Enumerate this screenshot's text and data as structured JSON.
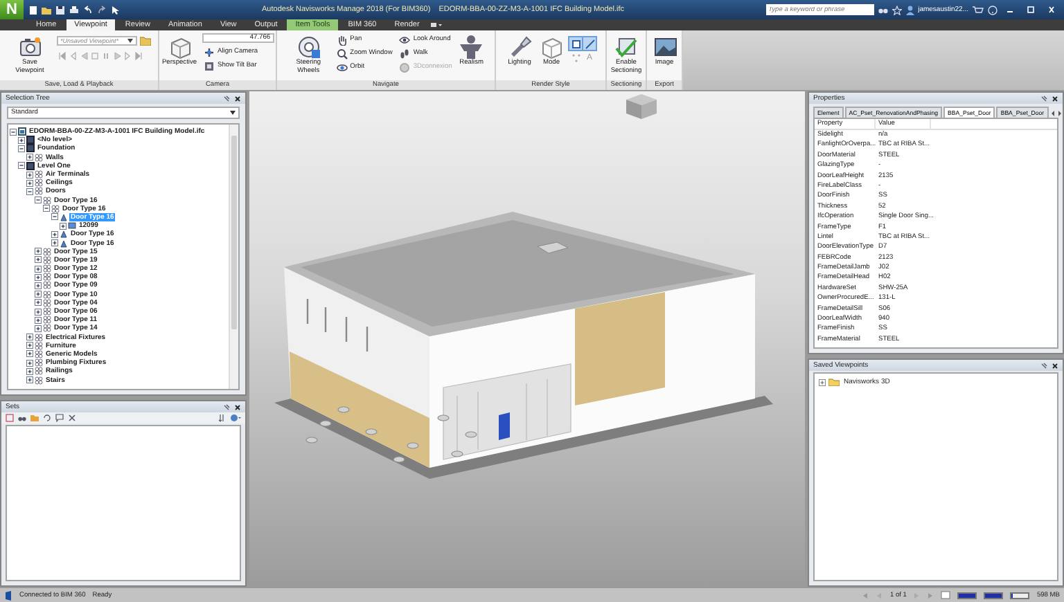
{
  "title_bar": {
    "logo": "N",
    "app_title": "Autodesk Navisworks Manage 2018 (For BIM360)",
    "document_title": "EDORM-BBA-00-ZZ-M3-A-1001 IFC Building Model.ifc",
    "search": {
      "placeholder": "Type a keyword or phrase"
    },
    "user": "jamesaustin22..."
  },
  "tabs": [
    {
      "label": "Home",
      "selected": false,
      "kind": "normal"
    },
    {
      "label": "Viewpoint",
      "selected": true,
      "kind": "normal"
    },
    {
      "label": "Review",
      "selected": false,
      "kind": "normal"
    },
    {
      "label": "Animation",
      "selected": false,
      "kind": "normal"
    },
    {
      "label": "View",
      "selected": false,
      "kind": "normal"
    },
    {
      "label": "Output",
      "selected": false,
      "kind": "normal"
    },
    {
      "label": "Item Tools",
      "selected": false,
      "kind": "contextual"
    },
    {
      "label": "BIM 360",
      "selected": false,
      "kind": "normal"
    },
    {
      "label": "Render",
      "selected": false,
      "kind": "normal"
    }
  ],
  "ribbon": {
    "panels": [
      {
        "title": "Save, Load & Playback",
        "columns": [
          [
            {
              "kind": "large",
              "label": "Save Viewpoint",
              "disabled": false
            }
          ],
          [
            {
              "kind": "dropdown",
              "value": "*Unsaved Viewpoint*"
            },
            {
              "kind": "playback"
            }
          ]
        ]
      },
      {
        "title": "Camera",
        "columns": [
          [
            {
              "kind": "large",
              "label": "Perspective",
              "disabled": false
            }
          ],
          [
            {
              "kind": "field",
              "value": "47.766"
            },
            {
              "kind": "small",
              "label": "Align Camera",
              "disabled": false
            },
            {
              "kind": "small",
              "label": "Show Tilt Bar",
              "disabled": false
            }
          ]
        ]
      },
      {
        "title": "Navigate",
        "columns": [
          [
            {
              "kind": "large",
              "label": "Steering Wheels",
              "disabled": false
            }
          ],
          [
            {
              "kind": "small",
              "label": "Pan",
              "disabled": false
            },
            {
              "kind": "small",
              "label": "Zoom Window",
              "disabled": false
            },
            {
              "kind": "small",
              "label": "Orbit",
              "disabled": false
            }
          ],
          [
            {
              "kind": "small",
              "label": "Look Around",
              "disabled": false
            },
            {
              "kind": "small",
              "label": "Walk",
              "disabled": false
            },
            {
              "kind": "small",
              "label": "3Dconnexion",
              "disabled": true
            }
          ],
          [
            {
              "kind": "large",
              "label": "Realism",
              "disabled": false
            }
          ]
        ]
      },
      {
        "title": "Render Style",
        "columns": [
          [
            {
              "kind": "large",
              "label": "Lighting",
              "disabled": false
            }
          ],
          [
            {
              "kind": "large",
              "label": "Mode",
              "disabled": false
            }
          ],
          [
            {
              "kind": "toggle",
              "selected": true
            },
            {
              "kind": "toggle",
              "selected": true
            },
            {
              "kind": "toggle",
              "selected": false
            },
            {
              "kind": "toggle",
              "selected": false,
              "label": "A"
            }
          ]
        ]
      },
      {
        "title": "Sectioning",
        "columns": [
          [
            {
              "kind": "large",
              "label": "Enable Sectioning",
              "disabled": false
            }
          ]
        ]
      },
      {
        "title": "Export",
        "columns": [
          [
            {
              "kind": "large",
              "label": "Image",
              "disabled": false
            }
          ]
        ]
      }
    ]
  },
  "selection_tree": {
    "title": "Selection Tree",
    "mode": "Standard",
    "items": [
      {
        "label": "EDORM-BBA-00-ZZ-M3-A-1001 IFC Building Model.ifc",
        "kind": "file",
        "expanded": true,
        "selected": false,
        "children": [
          {
            "label": "<No level>",
            "kind": "layer",
            "expanded": false,
            "selected": false
          },
          {
            "label": "Foundation",
            "kind": "layer",
            "expanded": true,
            "selected": false,
            "children": [
              {
                "label": "Walls",
                "kind": "collection",
                "expanded": false,
                "selected": false
              }
            ]
          },
          {
            "label": "Level One",
            "kind": "layer",
            "expanded": true,
            "selected": false,
            "children": [
              {
                "label": "Air Terminals",
                "kind": "collection",
                "expanded": false,
                "selected": false
              },
              {
                "label": "Ceilings",
                "kind": "collection",
                "expanded": false,
                "selected": false
              },
              {
                "label": "Doors",
                "kind": "collection",
                "expanded": true,
                "selected": false,
                "children": [
                  {
                    "label": "Door Type 16",
                    "kind": "collection",
                    "expanded": true,
                    "selected": false,
                    "children": [
                      {
                        "label": "Door Type 16",
                        "kind": "collection",
                        "expanded": true,
                        "selected": false,
                        "children": [
                          {
                            "label": "Door Type 16",
                            "kind": "instance",
                            "expanded": true,
                            "selected": true,
                            "children": [
                              {
                                "label": "12099",
                                "kind": "geometry",
                                "expanded": false,
                                "selected": false
                              }
                            ]
                          },
                          {
                            "label": "Door Type 16",
                            "kind": "instance",
                            "expanded": false,
                            "selected": false
                          },
                          {
                            "label": "Door Type 16",
                            "kind": "instance",
                            "expanded": false,
                            "selected": false
                          }
                        ]
                      }
                    ]
                  },
                  {
                    "label": "Door Type 15",
                    "kind": "collection",
                    "expanded": false,
                    "selected": false
                  },
                  {
                    "label": "Door Type 19",
                    "kind": "collection",
                    "expanded": false,
                    "selected": false
                  },
                  {
                    "label": "Door Type 12",
                    "kind": "collection",
                    "expanded": false,
                    "selected": false
                  },
                  {
                    "label": "Door Type 08",
                    "kind": "collection",
                    "expanded": false,
                    "selected": false
                  },
                  {
                    "label": "Door Type 09",
                    "kind": "collection",
                    "expanded": false,
                    "selected": false
                  },
                  {
                    "label": "Door Type 10",
                    "kind": "collection",
                    "expanded": false,
                    "selected": false
                  },
                  {
                    "label": "Door Type 04",
                    "kind": "collection",
                    "expanded": false,
                    "selected": false
                  },
                  {
                    "label": "Door Type 06",
                    "kind": "collection",
                    "expanded": false,
                    "selected": false
                  },
                  {
                    "label": "Door Type 11",
                    "kind": "collection",
                    "expanded": false,
                    "selected": false
                  },
                  {
                    "label": "Door Type 14",
                    "kind": "collection",
                    "expanded": false,
                    "selected": false
                  }
                ]
              },
              {
                "label": "Electrical Fixtures",
                "kind": "collection",
                "expanded": false,
                "selected": false
              },
              {
                "label": "Furniture",
                "kind": "collection",
                "expanded": false,
                "selected": false
              },
              {
                "label": "Generic Models",
                "kind": "collection",
                "expanded": false,
                "selected": false
              },
              {
                "label": "Plumbing Fixtures",
                "kind": "collection",
                "expanded": false,
                "selected": false
              },
              {
                "label": "Railings",
                "kind": "collection",
                "expanded": false,
                "selected": false
              },
              {
                "label": "Stairs",
                "kind": "collection",
                "expanded": false,
                "selected": false
              }
            ]
          }
        ]
      }
    ]
  },
  "sets": {
    "title": "Sets"
  },
  "properties": {
    "title": "Properties",
    "tabs": [
      {
        "label": "Element",
        "selected": false
      },
      {
        "label": "AC_Pset_RenovationAndPhasing",
        "selected": false
      },
      {
        "label": "BBA_Pset_Door",
        "selected": true
      },
      {
        "label": "BBA_Pset_Door",
        "selected": false
      }
    ],
    "columns": [
      "Property",
      "Value"
    ],
    "rows": [
      [
        "Sidelight",
        "n/a"
      ],
      [
        "FanlightOrOverpa...",
        "TBC at RIBA St..."
      ],
      [
        "DoorMaterial",
        "STEEL"
      ],
      [
        "GlazingType",
        "-"
      ],
      [
        "DoorLeafHeight",
        "2135"
      ],
      [
        "FireLabelClass",
        "-"
      ],
      [
        "DoorFinish",
        "SS"
      ],
      [
        "Thickness",
        "52"
      ],
      [
        "IfcOperation",
        "Single Door Sing..."
      ],
      [
        "FrameType",
        "F1"
      ],
      [
        "Lintel",
        "TBC at RIBA St..."
      ],
      [
        "DoorElevationType",
        "D7"
      ],
      [
        "FEBRCode",
        "2123"
      ],
      [
        "FrameDetailJamb",
        "J02"
      ],
      [
        "FrameDetailHead",
        "H02"
      ],
      [
        "HardwareSet",
        "SHW-25A"
      ],
      [
        "OwnerProcuredE...",
        "131-L"
      ],
      [
        "FrameDetailSill",
        "S06"
      ],
      [
        "DoorLeafWidth",
        "940"
      ],
      [
        "FrameFinish",
        "SS"
      ],
      [
        "FrameMaterial",
        "STEEL"
      ]
    ]
  },
  "saved_viewpoints": {
    "title": "Saved Viewpoints",
    "items": [
      {
        "label": "Navisworks 3D",
        "kind": "folder",
        "expanded": false,
        "selected": false
      }
    ]
  },
  "status_bar": {
    "connection": "Connected to BIM 360",
    "status": "Ready",
    "page": "1 of 1",
    "meters": [
      {
        "level": 0.95
      },
      {
        "level": 0.95
      },
      {
        "level": 0.05
      }
    ],
    "memory": "598 MB"
  }
}
